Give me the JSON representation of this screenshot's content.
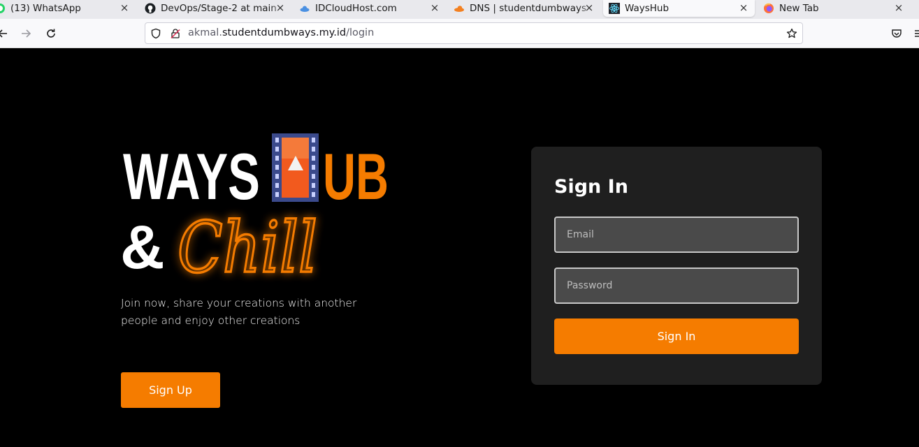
{
  "browser": {
    "tabs": [
      {
        "title": "(13) WhatsApp",
        "icon": "whatsapp-icon",
        "close": "×"
      },
      {
        "title": "DevOps/Stage-2 at main",
        "icon": "github-icon",
        "close": "×"
      },
      {
        "title": "IDCloudHost.com",
        "icon": "cloud-icon",
        "close": "×"
      },
      {
        "title": "DNS | studentdumbways",
        "icon": "cloudflare-icon",
        "close": "×"
      },
      {
        "title": "WaysHub",
        "icon": "react-icon",
        "close": "×"
      },
      {
        "title": "New Tab",
        "icon": "firefox-icon",
        "close": "×"
      }
    ],
    "active_tab": 4,
    "url": {
      "prefix": "akmal.",
      "host": "studentdumbways.my.id",
      "path": "/login"
    }
  },
  "hero": {
    "logo_word_ways": "WAYS",
    "logo_word_ub": "UB",
    "logo_amp": "&",
    "logo_script": "Chill",
    "tagline": "Join now, share your creations with another people and enjoy other creations",
    "signup_label": "Sign Up"
  },
  "signin": {
    "title": "Sign In",
    "email_placeholder": "Email",
    "email_value": "",
    "password_placeholder": "Password",
    "password_value": "",
    "button_label": "Sign In"
  },
  "colors": {
    "accent": "#f57c00",
    "card_bg": "#1f1f1f",
    "page_bg": "#000000",
    "film_frame": "#3b4a8c"
  }
}
